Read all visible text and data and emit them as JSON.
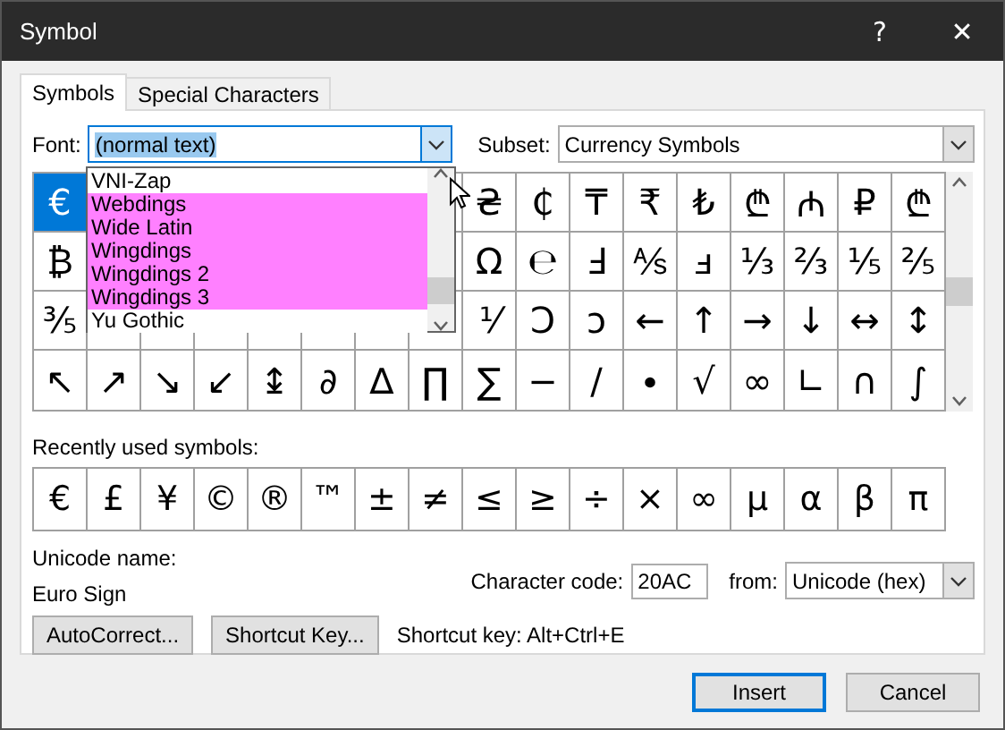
{
  "window": {
    "title": "Symbol",
    "help": "?",
    "close": "✕"
  },
  "tabs": [
    {
      "label": "Symbols",
      "selected": true
    },
    {
      "label": "Special Characters",
      "selected": false
    }
  ],
  "font": {
    "label": "Font:",
    "value": "(normal text)",
    "expanded": true,
    "options": [
      {
        "label": "VNI-Zap",
        "highlighted": false
      },
      {
        "label": "Webdings",
        "highlighted": true
      },
      {
        "label": "Wide Latin",
        "highlighted": true
      },
      {
        "label": "Wingdings",
        "highlighted": true
      },
      {
        "label": "Wingdings 2",
        "highlighted": true
      },
      {
        "label": "Wingdings 3",
        "highlighted": true
      },
      {
        "label": "Yu Gothic",
        "highlighted": false
      }
    ]
  },
  "subset": {
    "label": "Subset:",
    "value": "Currency Symbols"
  },
  "symbol_grid": [
    {
      "left": [
        {
          "char": "€",
          "selected": true
        }
      ],
      "right": [
        {
          "char": "₴",
          "selected": false
        },
        {
          "char": "₵",
          "selected": false
        },
        {
          "char": "₸",
          "selected": false
        },
        {
          "char": "₹",
          "selected": false
        },
        {
          "char": "₺",
          "selected": false
        },
        {
          "char": "₾",
          "selected": false
        },
        {
          "char": "₼",
          "selected": false
        },
        {
          "char": "₽",
          "selected": false
        },
        {
          "char": "₾",
          "selected": false
        }
      ]
    },
    {
      "left": [
        {
          "char": "₿",
          "selected": false
        }
      ],
      "right": [
        {
          "char": "Ω",
          "selected": false
        },
        {
          "char": "℮",
          "selected": false
        },
        {
          "char": "Ⅎ",
          "selected": false
        },
        {
          "char": "⅍",
          "selected": false
        },
        {
          "char": "ⅎ",
          "selected": false
        },
        {
          "char": "⅓",
          "selected": false
        },
        {
          "char": "⅔",
          "selected": false
        },
        {
          "char": "⅕",
          "selected": false
        },
        {
          "char": "⅖",
          "selected": false
        }
      ]
    },
    {
      "left": [
        {
          "char": "⅗",
          "selected": false
        }
      ],
      "right": [
        {
          "char": "⅟",
          "selected": false
        },
        {
          "char": "Ↄ",
          "selected": false
        },
        {
          "char": "ↄ",
          "selected": false
        },
        {
          "char": "←",
          "selected": false
        },
        {
          "char": "↑",
          "selected": false
        },
        {
          "char": "→",
          "selected": false
        },
        {
          "char": "↓",
          "selected": false
        },
        {
          "char": "↔",
          "selected": false
        },
        {
          "char": "↕",
          "selected": false
        }
      ]
    },
    {
      "left": [
        {
          "char": "↖",
          "selected": false
        },
        {
          "char": "↗",
          "selected": false
        },
        {
          "char": "↘",
          "selected": false
        },
        {
          "char": "↙",
          "selected": false
        },
        {
          "char": "↨",
          "selected": false
        },
        {
          "char": "∂",
          "selected": false
        },
        {
          "char": "∆",
          "selected": false
        },
        {
          "char": "∏",
          "selected": false
        },
        {
          "char": "∑",
          "selected": false
        },
        {
          "char": "−",
          "selected": false
        },
        {
          "char": "∕",
          "selected": false
        },
        {
          "char": "∙",
          "selected": false
        },
        {
          "char": "√",
          "selected": false
        },
        {
          "char": "∞",
          "selected": false
        },
        {
          "char": "∟",
          "selected": false
        },
        {
          "char": "∩",
          "selected": false
        },
        {
          "char": "∫",
          "selected": false
        }
      ]
    }
  ],
  "recently_used": {
    "label": "Recently used symbols:",
    "symbols": [
      "€",
      "£",
      "¥",
      "©",
      "®",
      "™",
      "±",
      "≠",
      "≤",
      "≥",
      "÷",
      "×",
      "∞",
      "µ",
      "α",
      "β",
      "π"
    ]
  },
  "unicode_name": {
    "label": "Unicode name:",
    "value": "Euro Sign"
  },
  "character_code": {
    "label": "Character code:",
    "value": "20AC"
  },
  "from": {
    "label": "from:",
    "value": "Unicode (hex)"
  },
  "buttons": [
    "AutoCorrect...",
    "Shortcut Key..."
  ],
  "shortcut_key": "Shortcut key: Alt+Ctrl+E",
  "footer_buttons": [
    {
      "label": "Insert",
      "default": true
    },
    {
      "label": "Cancel",
      "default": false
    }
  ]
}
